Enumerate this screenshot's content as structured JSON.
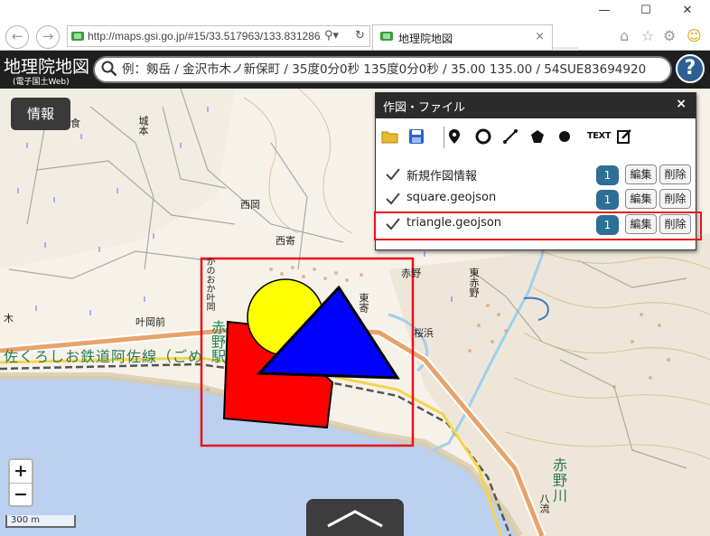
{
  "browser": {
    "url": "http://maps.gsi.go.jp/#15/33.517963/133.831286/",
    "tab_title": "地理院地図",
    "tab_close": "×",
    "window": {
      "minimize": "—",
      "maximize": "☐",
      "close": "✕"
    }
  },
  "header": {
    "logo": "地理院地図",
    "logo_sub": "(電子国土Web)",
    "search_placeholder": "例：剱岳 / 金沢市木ノ新保町 / 35度0分0秒 135度0分0秒 / 35.00 135.00 / 54SUE83694920",
    "help": "?"
  },
  "map": {
    "info_button": "情報",
    "labels": {
      "jo": "城本",
      "nishioka": "西岡",
      "nishiyose": "西寄",
      "akano_town": "赤野",
      "higashi_akano": "東赤野",
      "higashi_yose": "東寄",
      "sakurahama": "桜浜",
      "kanooka": "叶岡前",
      "kanooka_v": "かのおか叶岡",
      "akano_station": "赤野駅",
      "railway": "佐くろしお鉄道阿佐線（ごめ",
      "akano_river": "赤野川",
      "hachiryu": "八流",
      "ki": "木",
      "shoku": "食"
    },
    "zoom_in": "+",
    "zoom_out": "−",
    "scale": "300 m"
  },
  "panel": {
    "title": "作図・ファイル",
    "close": "×",
    "tools": [
      "open-folder",
      "save",
      "marker",
      "circle",
      "line",
      "polygon",
      "dot",
      "text",
      "edit"
    ],
    "text_tool": "TEXT",
    "layers": [
      {
        "name": "新規作図情報",
        "count": "1",
        "edit": "編集",
        "delete": "削除"
      },
      {
        "name": "square.geojson",
        "count": "1",
        "edit": "編集",
        "delete": "削除"
      },
      {
        "name": "triangle.geojson",
        "count": "1",
        "edit": "編集",
        "delete": "削除"
      }
    ]
  },
  "colors": {
    "highlight": "#e8141a",
    "shape_red": "#ff0000",
    "shape_yellow": "#ffff00",
    "shape_blue": "#0000ff",
    "sea": "#bcd0f0",
    "header_bg": "#1f1f1f",
    "badge": "#2d6f95"
  }
}
